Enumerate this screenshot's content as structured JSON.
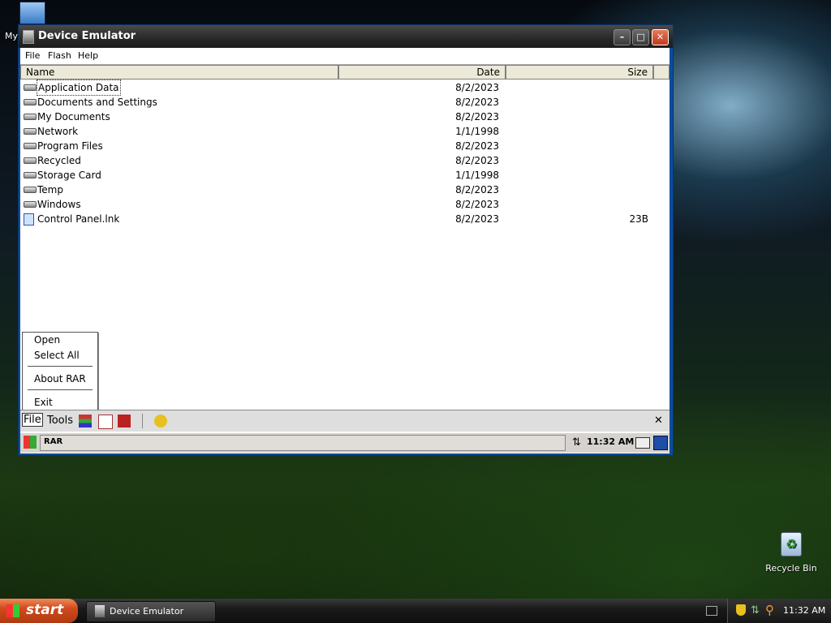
{
  "desktop": {
    "my_computer_label": "My",
    "recycle_bin_label": "Recycle Bin"
  },
  "window": {
    "title": "Device Emulator",
    "minimize": "–",
    "maximize": "□",
    "close": "✕"
  },
  "menubar": {
    "file": "File",
    "flash": "Flash",
    "help": "Help"
  },
  "columns": {
    "name": "Name",
    "date": "Date",
    "size": "Size"
  },
  "files": [
    {
      "name": "Application Data",
      "date": "8/2/2023",
      "size": "",
      "icon": "drive-folder-icon"
    },
    {
      "name": "Documents and Settings",
      "date": "8/2/2023",
      "size": "",
      "icon": "drive-folder-icon"
    },
    {
      "name": "My Documents",
      "date": "8/2/2023",
      "size": "",
      "icon": "drive-folder-icon"
    },
    {
      "name": "Network",
      "date": "1/1/1998",
      "size": "",
      "icon": "drive-folder-icon"
    },
    {
      "name": "Program Files",
      "date": "8/2/2023",
      "size": "",
      "icon": "drive-folder-icon"
    },
    {
      "name": "Recycled",
      "date": "8/2/2023",
      "size": "",
      "icon": "drive-folder-icon"
    },
    {
      "name": "Storage Card",
      "date": "1/1/1998",
      "size": "",
      "icon": "drive-folder-icon"
    },
    {
      "name": "Temp",
      "date": "8/2/2023",
      "size": "",
      "icon": "drive-folder-icon"
    },
    {
      "name": "Windows",
      "date": "8/2/2023",
      "size": "",
      "icon": "drive-folder-icon"
    },
    {
      "name": "Control Panel.lnk",
      "date": "8/2/2023",
      "size": "23B",
      "icon": "shortcut-icon"
    }
  ],
  "popup_menu": {
    "open": "Open",
    "select_all": "Select All",
    "about": "About RAR",
    "exit": "Exit"
  },
  "cmdbar": {
    "file": "File",
    "tools": "Tools",
    "close": "✕"
  },
  "wm_taskbar": {
    "app": "RAR",
    "time": "11:32 AM"
  },
  "xp_taskbar": {
    "start": "start",
    "task": "Device Emulator",
    "time": "11:32 AM"
  },
  "colors": {
    "accent": "#0c4d9a",
    "start": "#d04a1c"
  }
}
